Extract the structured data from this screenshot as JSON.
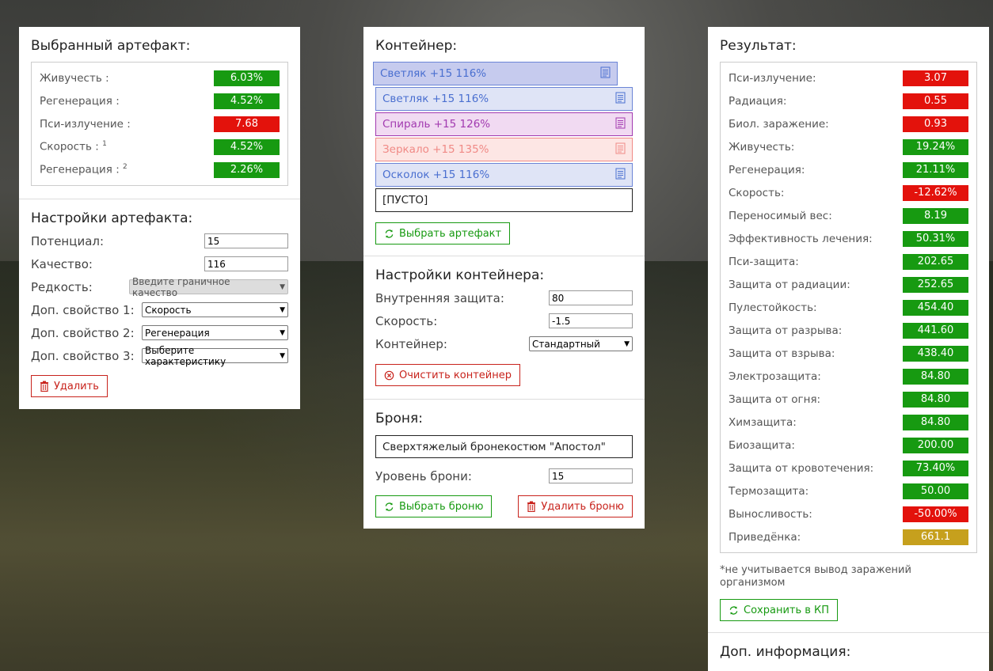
{
  "artifact_panel": {
    "selected_title": "Выбранный артефакт:",
    "stats": [
      {
        "label": "Живучесть :",
        "sup": "",
        "value": "6.03%",
        "color": "green"
      },
      {
        "label": "Регенерация :",
        "sup": "",
        "value": "4.52%",
        "color": "green"
      },
      {
        "label": "Пси-излучение :",
        "sup": "",
        "value": "7.68",
        "color": "red"
      },
      {
        "label": "Скорость :",
        "sup": "1",
        "value": "4.52%",
        "color": "green"
      },
      {
        "label": "Регенерация :",
        "sup": "2",
        "value": "2.26%",
        "color": "green"
      }
    ],
    "settings_title": "Настройки артефакта:",
    "potential_label": "Потенциал:",
    "potential_value": "15",
    "quality_label": "Качество:",
    "quality_value": "116",
    "rarity_label": "Редкость:",
    "rarity_value": "Введите граничное качество",
    "extra1_label": "Доп. свойство 1:",
    "extra1_value": "Скорость",
    "extra2_label": "Доп. свойство 2:",
    "extra2_value": "Регенерация",
    "extra3_label": "Доп. свойство 3:",
    "extra3_value": "Выберите характеристику",
    "delete_label": "Удалить"
  },
  "container_panel": {
    "title": "Контейнер:",
    "slots": [
      {
        "label": "Светляк +15 116%",
        "style": "blue1"
      },
      {
        "label": "Светляк +15 116%",
        "style": "blue2"
      },
      {
        "label": "Спираль +15 126%",
        "style": "purple"
      },
      {
        "label": "Зеркало +15 135%",
        "style": "pink"
      },
      {
        "label": "Осколок +15 116%",
        "style": "blue2"
      },
      {
        "label": "[ПУСТО]",
        "style": "empty"
      }
    ],
    "choose_artifact_label": "Выбрать артефакт",
    "settings_title": "Настройки контейнера:",
    "inner_protection_label": "Внутренняя защита:",
    "inner_protection_value": "80",
    "speed_label": "Скорость:",
    "speed_value": "-1.5",
    "container_label": "Контейнер:",
    "container_value": "Стандартный",
    "clear_label": "Очистить контейнер",
    "armor_title": "Броня:",
    "armor_name": "Сверхтяжелый бронекостюм \"Апостол\"",
    "armor_level_label": "Уровень брони:",
    "armor_level_value": "15",
    "choose_armor_label": "Выбрать броню",
    "delete_armor_label": "Удалить броню"
  },
  "result_panel": {
    "title": "Результат:",
    "stats": [
      {
        "label": "Пси-излучение:",
        "value": "3.07",
        "color": "red"
      },
      {
        "label": "Радиация:",
        "value": "0.55",
        "color": "red"
      },
      {
        "label": "Биол. заражение:",
        "value": "0.93",
        "color": "red"
      },
      {
        "label": "Живучесть:",
        "value": "19.24%",
        "color": "green"
      },
      {
        "label": "Регенерация:",
        "value": "21.11%",
        "color": "green"
      },
      {
        "label": "Скорость:",
        "value": "-12.62%",
        "color": "red"
      },
      {
        "label": "Переносимый вес:",
        "value": "8.19",
        "color": "green"
      },
      {
        "label": "Эффективность лечения:",
        "value": "50.31%",
        "color": "green"
      },
      {
        "label": "Пси-защита:",
        "value": "202.65",
        "color": "green"
      },
      {
        "label": "Защита от радиации:",
        "value": "252.65",
        "color": "green"
      },
      {
        "label": "Пулестойкость:",
        "value": "454.40",
        "color": "green"
      },
      {
        "label": "Защита от разрыва:",
        "value": "441.60",
        "color": "green"
      },
      {
        "label": "Защита от взрыва:",
        "value": "438.40",
        "color": "green"
      },
      {
        "label": "Электрозащита:",
        "value": "84.80",
        "color": "green"
      },
      {
        "label": "Защита от огня:",
        "value": "84.80",
        "color": "green"
      },
      {
        "label": "Химзащита:",
        "value": "84.80",
        "color": "green"
      },
      {
        "label": "Биозащита:",
        "value": "200.00",
        "color": "green"
      },
      {
        "label": "Защита от кровотечения:",
        "value": "73.40%",
        "color": "green"
      },
      {
        "label": "Термозащита:",
        "value": "50.00",
        "color": "green"
      },
      {
        "label": "Выносливость:",
        "value": "-50.00%",
        "color": "red"
      },
      {
        "label": "Приведёнка:",
        "value": "661.1",
        "color": "gold"
      }
    ],
    "note": "*не учитывается вывод заражений организмом",
    "save_label": "Сохранить в КП",
    "extra_info_title": "Доп. информация:"
  },
  "colors": {
    "green": "#179a11",
    "red": "#e3120c",
    "gold": "#c6a01d"
  },
  "icons": {
    "trash": "trash-icon",
    "refresh": "refresh-icon",
    "clear": "clear-circle-icon",
    "doc": "document-icon"
  }
}
